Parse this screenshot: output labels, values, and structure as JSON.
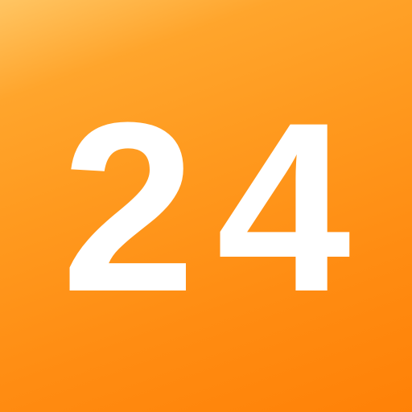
{
  "tile": {
    "number": "24",
    "text_color": "#FFFFFF",
    "gradient_top": "#FFC563",
    "gradient_bottom": "#FF8107"
  }
}
